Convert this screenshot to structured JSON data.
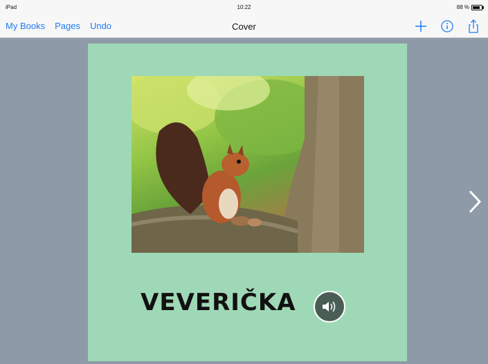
{
  "status_bar": {
    "device": "iPad",
    "time": "10:22",
    "battery": "88 %",
    "battery_level": 0.88
  },
  "nav_bar": {
    "my_books_label": "My Books",
    "pages_label": "Pages",
    "undo_label": "Undo",
    "title": "Cover",
    "icons": [
      "plus-icon",
      "info-icon",
      "share-icon"
    ]
  },
  "page": {
    "word": "VEVERIČKA",
    "background": "#9fd8b6",
    "image_subject": "red squirrel on tree branch",
    "sound_icon": "speaker-icon"
  },
  "navigation": {
    "next_icon": "chevron-right-icon"
  },
  "colors": {
    "accent": "#1e7cf2",
    "canvas": "#8e9aa8",
    "sound_button": "#4a5d55"
  }
}
